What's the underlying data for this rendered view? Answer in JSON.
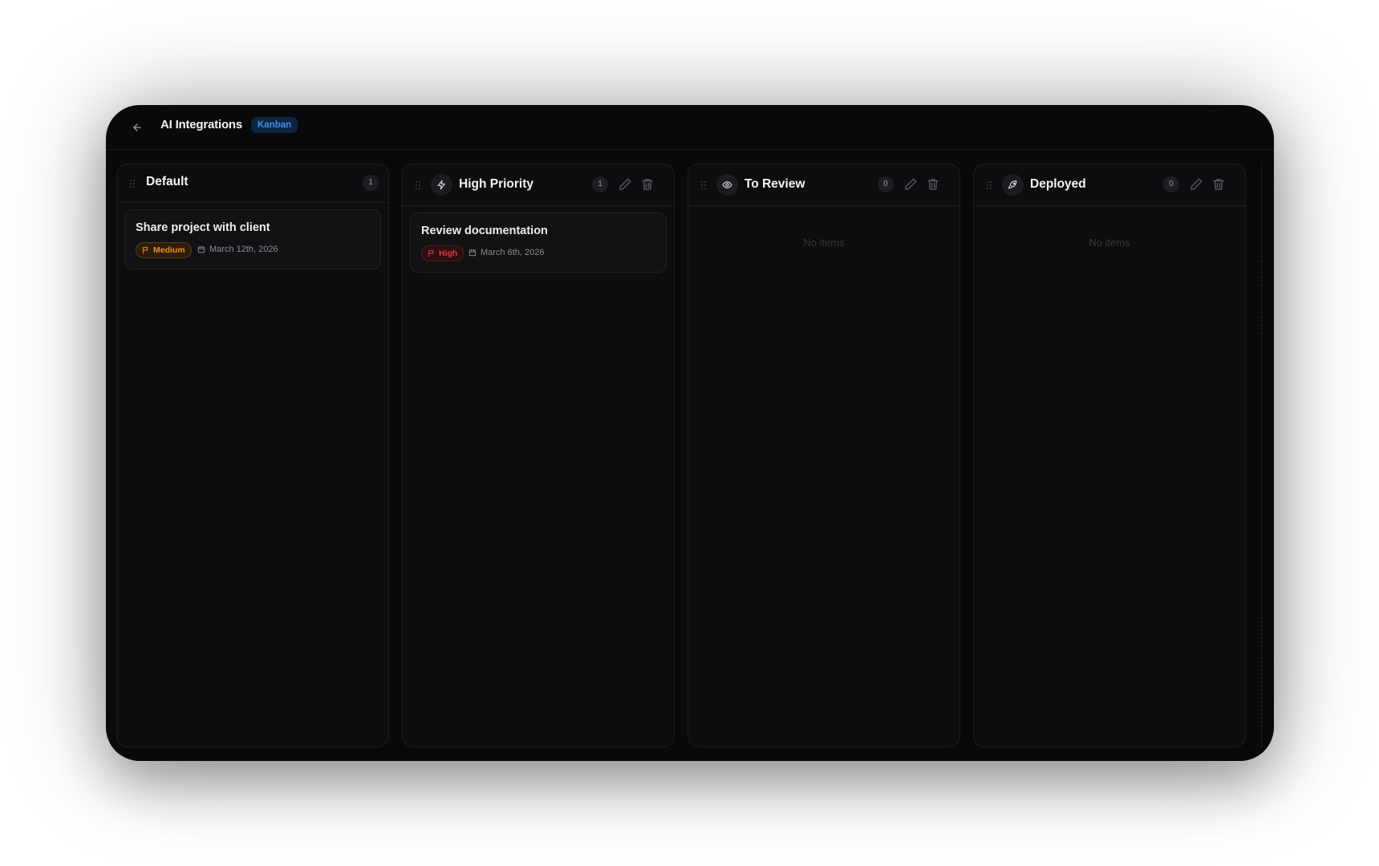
{
  "app": {
    "title": "AI Integrations",
    "view_badge": "Kanban",
    "accent_color": "#3b8fe8"
  },
  "columns": [
    {
      "title": "Default",
      "icon": null,
      "count": "1",
      "cards": [
        {
          "title": "Share project with client",
          "priority": "Medium",
          "priority_color": "#f08a1c",
          "date": "March 12th, 2026"
        }
      ]
    },
    {
      "title": "High Priority",
      "icon": "bolt-icon",
      "count": "1",
      "cards": [
        {
          "title": "Review documentation",
          "priority": "High",
          "priority_color": "#e5343f",
          "date": "March 6th, 2026"
        }
      ]
    },
    {
      "title": "To Review",
      "icon": "eye-icon",
      "count": "0",
      "empty_text": "No items",
      "cards": []
    },
    {
      "title": "Deployed",
      "icon": "rocket-icon",
      "count": "0",
      "empty_text": "No items",
      "cards": []
    }
  ]
}
